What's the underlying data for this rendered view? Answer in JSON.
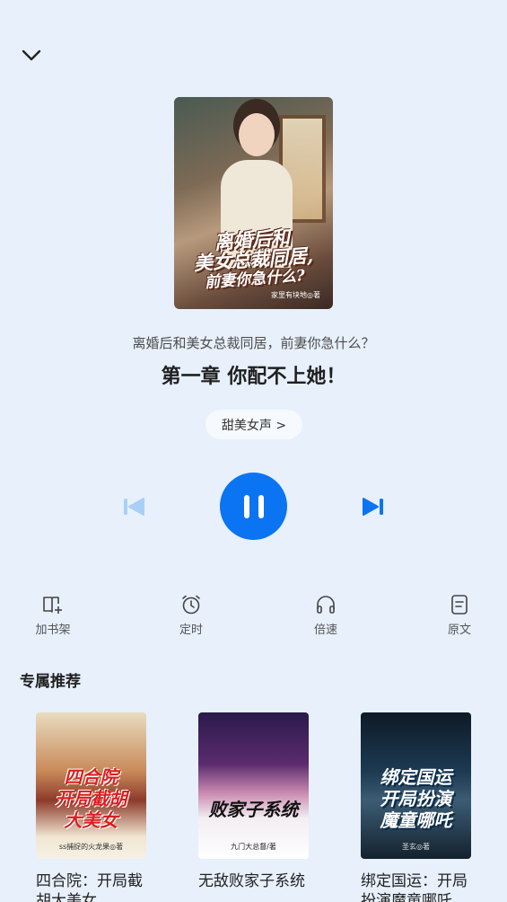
{
  "player": {
    "book_title": "离婚后和美女总裁同居，前妻你急什么？",
    "chapter_title": "第一章 你配不上她！",
    "voice_label": "甜美女声 >",
    "state": "playing",
    "accent_color": "#0a74f2",
    "cover": {
      "title_line1": "离婚后和",
      "title_line2": "美女总裁同居,",
      "title_line3": "前妻你急什么?",
      "author": "家里有块地◎著"
    },
    "icons": {
      "collapse": "chevron-down-icon",
      "prev": "skip-previous-icon",
      "play_pause": "pause-icon",
      "next": "skip-next-icon"
    }
  },
  "toolbar": [
    {
      "label": "加书架",
      "icon": "add-bookshelf-icon"
    },
    {
      "label": "定时",
      "icon": "alarm-clock-icon"
    },
    {
      "label": "倍速",
      "icon": "headphones-icon"
    },
    {
      "label": "原文",
      "icon": "document-icon"
    }
  ],
  "recommendations": {
    "heading": "专属推荐",
    "items": [
      {
        "name": "四合院：开局截胡大美女",
        "cover_text": "四合院\n开局截胡\n大美女",
        "cover_author": "ss捕捉的火龙果◎著"
      },
      {
        "name": "无敌败家子系统",
        "cover_text": "败家子系统",
        "cover_author": "九门大总督/著"
      },
      {
        "name": "绑定国运：开局扮演魔童哪吒",
        "cover_text": "绑定国运\n开局扮演\n魔童哪吒",
        "cover_author": "圣玄◎著"
      }
    ]
  }
}
